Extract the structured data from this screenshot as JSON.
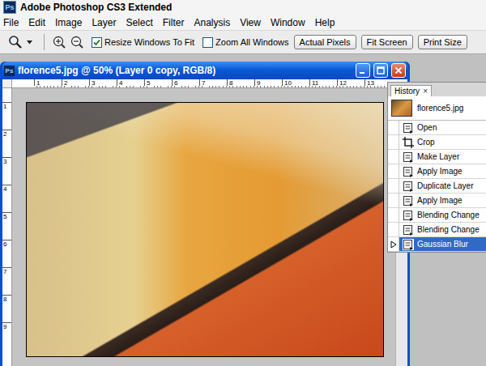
{
  "app": {
    "icon": "Ps",
    "title": "Adobe Photoshop CS3 Extended"
  },
  "menu": [
    "File",
    "Edit",
    "Image",
    "Layer",
    "Select",
    "Filter",
    "Analysis",
    "View",
    "Window",
    "Help"
  ],
  "options_bar": {
    "checkboxes": [
      {
        "label": "Resize Windows To Fit",
        "checked": true
      },
      {
        "label": "Zoom All Windows",
        "checked": false
      }
    ],
    "buttons": [
      "Actual Pixels",
      "Fit Screen",
      "Print Size"
    ]
  },
  "document": {
    "icon": "Ps",
    "title": "florence5.jpg @ 50% (Layer 0 copy, RGB/8)",
    "ruler_top": [
      "1",
      "2",
      "3",
      "4",
      "5",
      "6",
      "7",
      "8",
      "9",
      "10",
      "11",
      "12",
      "13"
    ],
    "ruler_left": [
      "1",
      "2",
      "3",
      "4",
      "5",
      "6",
      "7",
      "8",
      "9"
    ]
  },
  "history": {
    "tab": "History",
    "close": "×",
    "snapshot": "florence5.jpg",
    "items": [
      {
        "label": "Open",
        "kind": "step",
        "selected": false
      },
      {
        "label": "Crop",
        "kind": "crop",
        "selected": false
      },
      {
        "label": "Make Layer",
        "kind": "step",
        "selected": false
      },
      {
        "label": "Apply Image",
        "kind": "step",
        "selected": false
      },
      {
        "label": "Duplicate Layer",
        "kind": "step",
        "selected": false
      },
      {
        "label": "Apply Image",
        "kind": "step",
        "selected": false
      },
      {
        "label": "Blending Change",
        "kind": "step",
        "selected": false
      },
      {
        "label": "Blending Change",
        "kind": "step",
        "selected": false
      },
      {
        "label": "Gaussian Blur",
        "kind": "step",
        "selected": true
      }
    ]
  }
}
